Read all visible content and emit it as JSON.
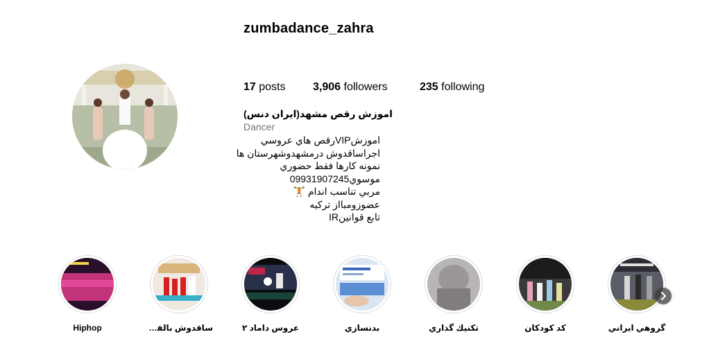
{
  "profile": {
    "username": "zumbadance_zahra",
    "avatar_icon": "profile-photo-bride-with-bridesmaids"
  },
  "stats": {
    "posts_count": "17",
    "posts_label": " posts",
    "followers_count": "3,906",
    "followers_label": " followers",
    "following_count": "235",
    "following_label": " following"
  },
  "bio": {
    "name": "اموزش رقص مشهد(ایران دنس)",
    "category": "Dancer",
    "lines": [
      "اموزشVIPرقص هاي عروسي",
      "اجراساقدوش درمشهدوشهرستان ها",
      "نمونه كارها فقط حضوري",
      "موسوي09931907245",
      "مربي تناسب اندام 🏋",
      "عضوزومبااز تركيه",
      "تابع قوانينIR"
    ]
  },
  "highlights": [
    {
      "label": "Hiphop",
      "icon": "highlight-hiphop-thumbnail"
    },
    {
      "label": "ساقدوش بالفر...",
      "icon": "highlight-bridesmaids-thumbnail"
    },
    {
      "label": "عروس داماد ۲",
      "icon": "highlight-bride-groom-thumbnail"
    },
    {
      "label": "بدنسازي",
      "icon": "highlight-bodybuilding-thumbnail"
    },
    {
      "label": "تكنيك گذاري",
      "icon": "highlight-technique-thumbnail"
    },
    {
      "label": "كد كودكان",
      "icon": "highlight-kids-thumbnail"
    },
    {
      "label": "گروهي ايراني",
      "icon": "highlight-group-thumbnail"
    }
  ],
  "controls": {
    "next_icon": "chevron-right-icon"
  },
  "colors": {
    "secondary_text": "#737373",
    "ring_border": "#dbdbdb"
  }
}
